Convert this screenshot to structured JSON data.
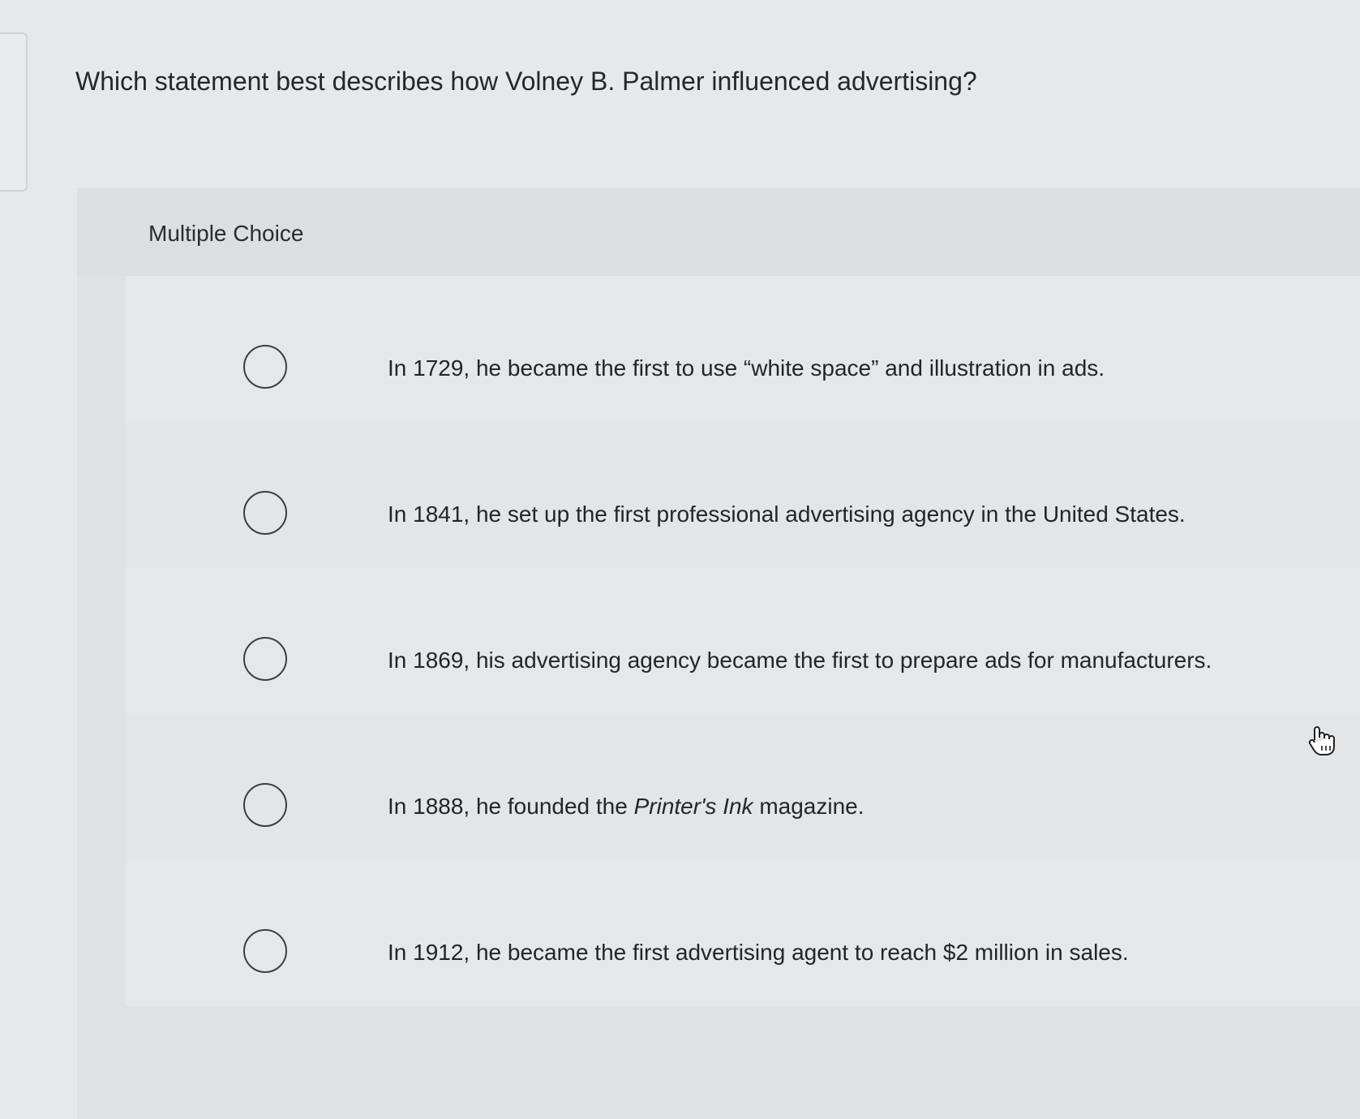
{
  "question": {
    "text": "Which statement best describes how Volney B. Palmer influenced advertising?"
  },
  "choice_section": {
    "label": "Multiple Choice"
  },
  "options": [
    {
      "prefix": "In 1729, he became the first to use “white space” and illustration in ads.",
      "italic": "",
      "suffix": "",
      "selected": false
    },
    {
      "prefix": "In 1841, he set up the first professional advertising agency in the United States.",
      "italic": "",
      "suffix": "",
      "selected": false
    },
    {
      "prefix": "In 1869, his advertising agency became the first to prepare ads for manufacturers.",
      "italic": "",
      "suffix": "",
      "selected": false
    },
    {
      "prefix": "In 1888, he founded the ",
      "italic": "Printer's Ink",
      "suffix": " magazine.",
      "selected": false
    },
    {
      "prefix": "In 1912, he became the first advertising agent to reach $2 million in sales.",
      "italic": "",
      "suffix": "",
      "selected": false
    }
  ],
  "icons": {
    "radio": "radio-unchecked-icon",
    "cursor": "hand-pointer-icon"
  }
}
